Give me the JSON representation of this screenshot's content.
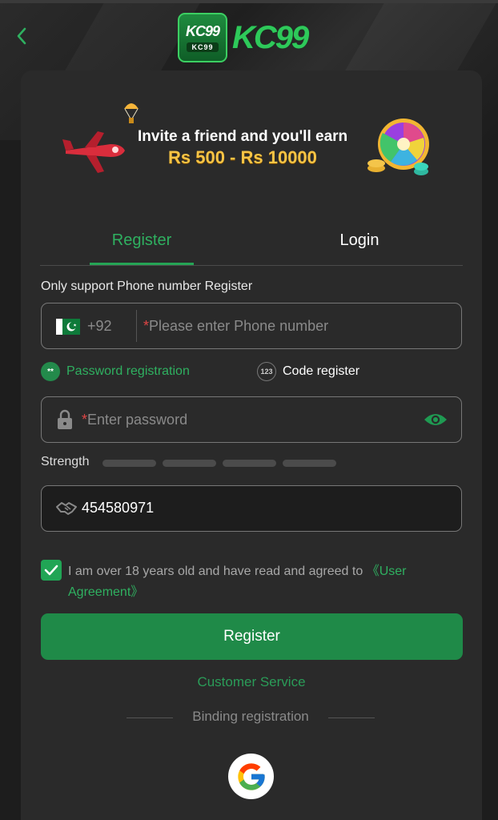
{
  "header": {
    "logo_badge_big": "KC99",
    "logo_badge_small": "KC99",
    "logo_text": "KC99"
  },
  "banner": {
    "line1": "Invite a friend and you'll earn",
    "line2": "Rs 500 - Rs 10000"
  },
  "tabs": [
    {
      "label": "Register",
      "active": true
    },
    {
      "label": "Login",
      "active": false
    }
  ],
  "form": {
    "support_label": "Only support Phone number Register",
    "phone": {
      "country_code": "+92",
      "required_mark": "*",
      "placeholder": "Please enter Phone number"
    },
    "modes": {
      "password_dot": "**",
      "password_label": "Password registration",
      "code_dot": "123",
      "code_label": "Code register"
    },
    "password": {
      "required_mark": "*",
      "placeholder": "Enter password"
    },
    "strength_label": "Strength",
    "invite_code_value": "454580971",
    "agreement": {
      "text": "I am over 18 years old and have read and agreed to ",
      "link": "《User Agreement》",
      "checked": true
    },
    "register_button": "Register"
  },
  "footer": {
    "customer_service": "Customer Service",
    "binding_registration": "Binding registration"
  },
  "colors": {
    "accent": "#2fb060",
    "button": "#1f8a48",
    "card": "#2a2a2a",
    "background": "#1d1d1d"
  },
  "icons": {
    "back": "chevron-left-icon",
    "lock": "lock-icon",
    "eye": "eye-icon",
    "handshake": "handshake-icon",
    "check": "check-icon",
    "google": "google-icon"
  }
}
